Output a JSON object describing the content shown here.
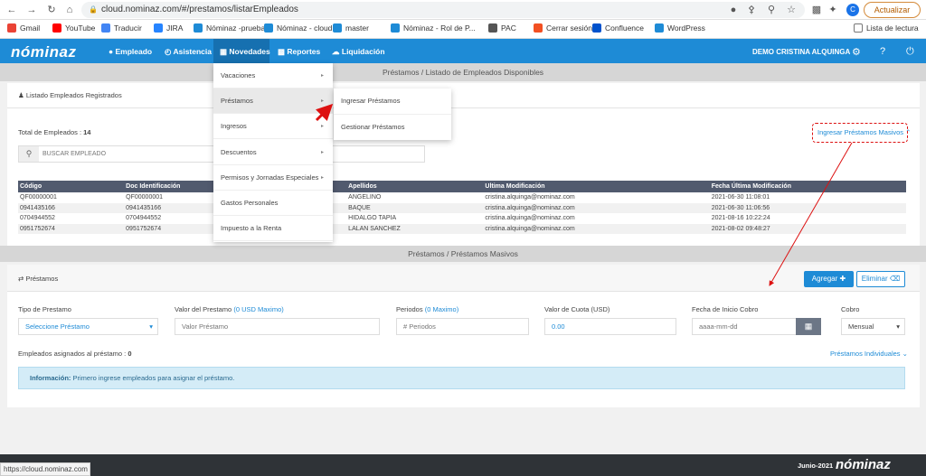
{
  "browser": {
    "url": "cloud.nominaz.com/#/prestamos/listarEmpleados",
    "update_label": "Actualizar",
    "avatar_letter": "C",
    "bookmarks": [
      {
        "label": "Gmail",
        "color": "#ea4335"
      },
      {
        "label": "YouTube",
        "color": "#ff0000"
      },
      {
        "label": "Traducir",
        "color": "#4285f4"
      },
      {
        "label": "JIRA",
        "color": "#2684ff"
      },
      {
        "label": "Nóminaz -pruebas",
        "color": "#1e8bd6"
      },
      {
        "label": "Nóminaz - cloud",
        "color": "#1e8bd6"
      },
      {
        "label": "master",
        "color": "#1e8bd6"
      },
      {
        "label": "Nóminaz - Rol de P...",
        "color": "#1e8bd6"
      },
      {
        "label": "PAC",
        "color": "#555555"
      },
      {
        "label": "Cerrar sesión",
        "color": "#f25022"
      },
      {
        "label": "Confluence",
        "color": "#0052cc"
      },
      {
        "label": "WordPress",
        "color": "#1e8bd6"
      }
    ],
    "reading_list": "Lista de lectura"
  },
  "app": {
    "logo": "nóminaz",
    "nav": [
      "Empleado",
      "Asistencia",
      "Novedades",
      "Reportes",
      "Liquidación"
    ],
    "user": "DEMO CRISTINA ALQUINGA",
    "page_title": "Préstamos / Listado de Empleados Disponibles",
    "section2_title": "Préstamos / Préstamos Masivos"
  },
  "list": {
    "header": "Listado Empleados Registrados",
    "total_label": "Total de Empleados :",
    "total": "14",
    "search_placeholder": "BUSCAR EMPLEADO",
    "bulk_link": "Ingresar Préstamos Masivos",
    "columns": [
      "Código",
      "Doc Identificación",
      "",
      "Apellidos",
      "Ultima Modificación",
      "Fecha Última Modificación"
    ],
    "rows": [
      [
        "QF00000001",
        "QF00000001",
        "",
        "ANGELINO",
        "cristina.alquinga@nominaz.com",
        "2021-06-30 11:08:01"
      ],
      [
        "0941435166",
        "0941435166",
        "",
        "BAQUE",
        "cristina.alquinga@nominaz.com",
        "2021-06-30 11:06:56"
      ],
      [
        "0704944552",
        "0704944552",
        "",
        "HIDALGO TAPIA",
        "cristina.alquinga@nominaz.com",
        "2021-08-16 10:22:24"
      ],
      [
        "0951752674",
        "0951752674",
        "",
        "LALAN SANCHEZ",
        "cristina.alquinga@nominaz.com",
        "2021-08-02 09:48:27"
      ]
    ]
  },
  "menu": {
    "items": [
      "Vacaciones",
      "Préstamos",
      "Ingresos",
      "Descuentos",
      "Permisos y Jornadas Especiales",
      "Gastos Personales",
      "Impuesto a la Renta"
    ],
    "sub": [
      "Ingresar Préstamos",
      "Gestionar Préstamos"
    ]
  },
  "form": {
    "header": "Préstamos",
    "add": "Agregar",
    "remove": "Eliminar",
    "tipo_label": "Tipo de Prestamo",
    "tipo_value": "Seleccione Préstamo",
    "valor_label": "Valor del Prestamo",
    "valor_hint": "(0 USD Maximo)",
    "valor_placeholder": "Valor Préstamo",
    "periodos_label": "Periodos",
    "periodos_hint": "(0 Maximo)",
    "periodos_placeholder": "# Periodos",
    "cuota_label": "Valor de Cuota (USD)",
    "cuota_value": "0.00",
    "fecha_label": "Fecha de Inicio Cobro",
    "fecha_placeholder": "aaaa-mm-dd",
    "cobro_label": "Cobro",
    "cobro_value": "Mensual",
    "asignados_label": "Empleados asignados al préstamo :",
    "asignados": "0",
    "individuales": "Préstamos Individuales",
    "info_bold": "Información:",
    "info_text": "Primero ingrese empleados para asignar el préstamo."
  },
  "footer": {
    "date": "Junio-2021",
    "logo": "nóminaz"
  },
  "status_url": "https://cloud.nominaz.com"
}
